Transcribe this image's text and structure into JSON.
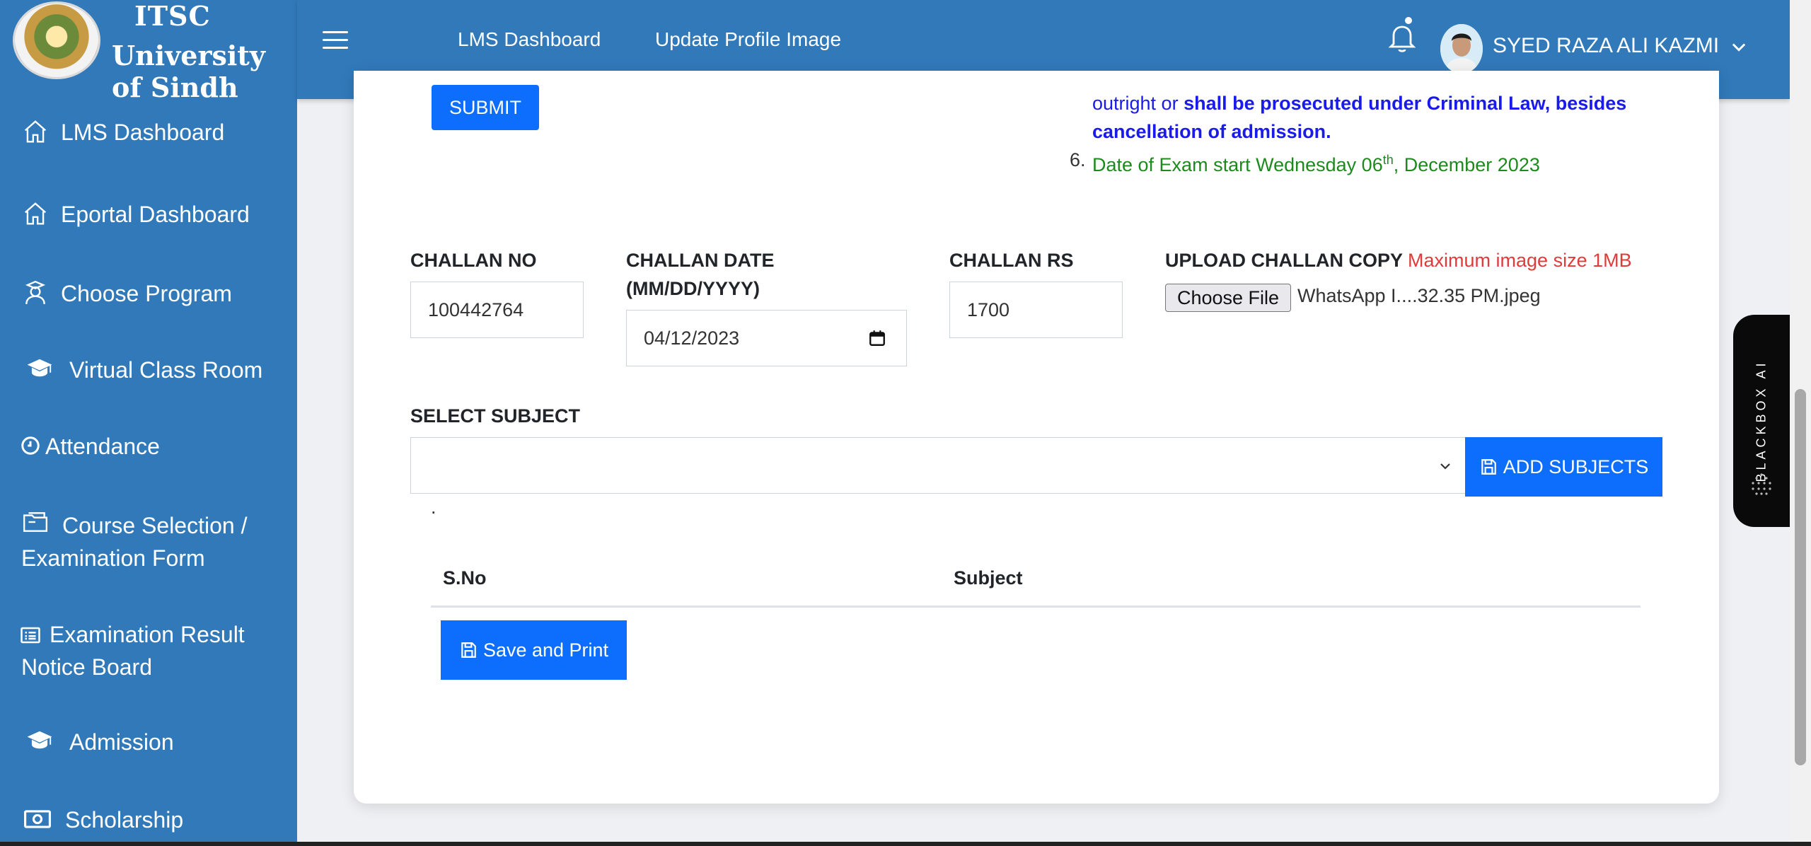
{
  "brand": {
    "top": "ITSC",
    "bottom": "University of Sindh"
  },
  "sidebar": {
    "items": [
      {
        "label": "LMS Dashboard",
        "icon": "home-icon"
      },
      {
        "label": "Eportal Dashboard",
        "icon": "home-icon"
      },
      {
        "label": "Choose Program",
        "icon": "user-graduate-icon"
      },
      {
        "label": "Virtual Class Room",
        "icon": "graduation-cap-icon"
      },
      {
        "label": "Attendance",
        "icon": "clock-icon"
      },
      {
        "label": "Course Selection / Examination Form",
        "icon": "folder-icon"
      },
      {
        "label": "Examination Result Notice Board",
        "icon": "list-icon"
      },
      {
        "label": "Admission",
        "icon": "graduation-cap-icon"
      },
      {
        "label": "Scholarship",
        "icon": "money-bill-icon"
      }
    ]
  },
  "topbar": {
    "links": [
      "LMS Dashboard",
      "Update Profile Image"
    ],
    "username": "SYED RAZA ALI KAZMI"
  },
  "form": {
    "submit_label": "SUBMIT",
    "instructions": {
      "line1_plain": "outright or ",
      "line1_bold": "shall be prosecuted under Criminal Law, besides",
      "line2_bold": "cancellation of admission.",
      "item6_number": "6.",
      "item6_text": "Date of Exam start Wednesday 06",
      "item6_sup": "th",
      "item6_tail": ", December 2023"
    },
    "challan_no": {
      "label": "CHALLAN NO",
      "value": "100442764"
    },
    "challan_date": {
      "label_line1": "CHALLAN DATE",
      "label_line2": "(MM/DD/YYYY)",
      "value": "04/12/2023"
    },
    "challan_rs": {
      "label": "CHALLAN RS",
      "value": "1700"
    },
    "upload": {
      "label": "UPLOAD CHALLAN COPY",
      "note": "Maximum image size 1MB",
      "button": "Choose File",
      "file_name": "WhatsApp I....32.35 PM.jpeg"
    },
    "select_subject": {
      "label": "SELECT SUBJECT",
      "value": ""
    },
    "add_subjects_label": "ADD SUBJECTS",
    "dot": ".",
    "table": {
      "headers": [
        "S.No",
        "Subject"
      ]
    },
    "save_print_label": "Save and Print"
  },
  "widget": {
    "label": "BLACKBOX AI"
  },
  "colors": {
    "sidebar_bg": "#3179b9",
    "primary_button": "#0d6efd",
    "instruction_blue": "#1a1aeb",
    "instruction_green": "#1d8a1d",
    "note_red": "#e03b3b"
  }
}
